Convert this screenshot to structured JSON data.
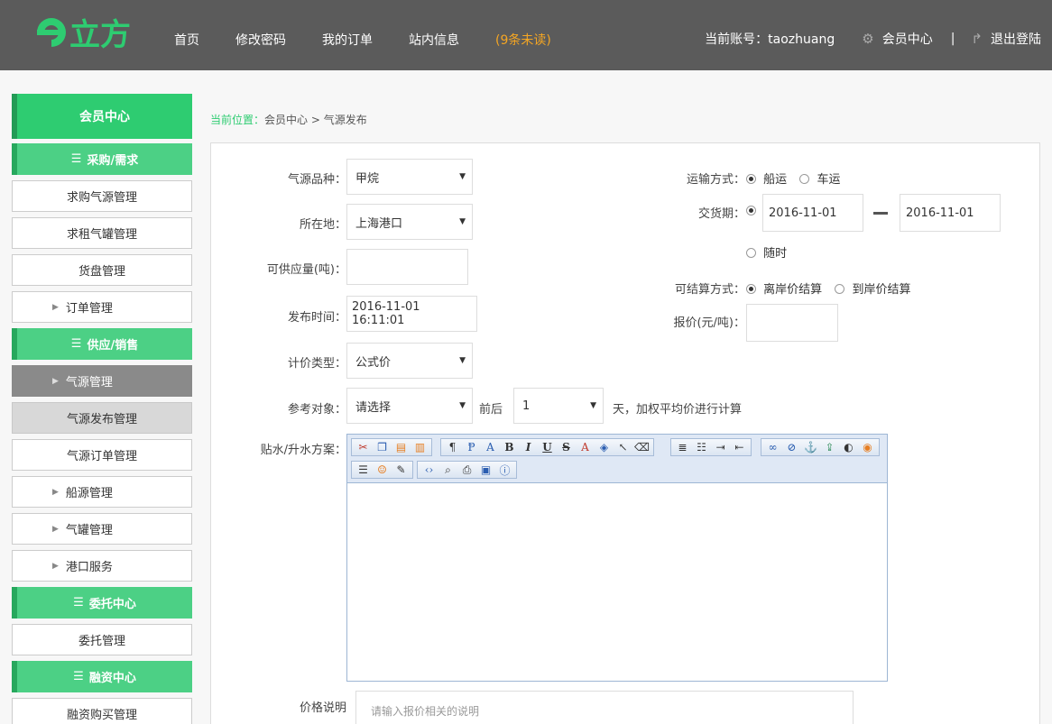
{
  "header": {
    "logo_text": "e立方",
    "nav": [
      "首页",
      "修改密码",
      "我的订单",
      "站内信息"
    ],
    "unread_text": "(9条未读)",
    "account_text": "当前账号：taozhuang",
    "member_center": "会员中心",
    "separator": "|",
    "logout": "退出登陆"
  },
  "sidebar": {
    "title": "会员中心",
    "groups": [
      {
        "label": "采购/需求",
        "items": [
          "求购气源管理",
          "求租气罐管理",
          "货盘管理",
          "订单管理"
        ]
      },
      {
        "label": "供应/销售",
        "items": [
          "气源管理",
          "气源发布管理",
          "气源订单管理",
          "船源管理",
          "气罐管理",
          "港口服务"
        ]
      },
      {
        "label": "委托中心",
        "items": [
          "委托管理"
        ]
      },
      {
        "label": "融资中心",
        "items": [
          "融资购买管理"
        ]
      }
    ]
  },
  "breadcrumb": {
    "lead": "当前位置：",
    "path": "会员中心 > 气源发布"
  },
  "form": {
    "gas_type_label": "气源品种：",
    "gas_type_value": "甲烷",
    "location_label": "所在地：",
    "location_value": "上海港口",
    "supply_label": "可供应量(吨)：",
    "supply_value": "",
    "publish_time_label": "发布时间：",
    "publish_time_value": "2016-11-01 16:11:01",
    "pricing_type_label": "计价类型：",
    "pricing_type_value": "公式价",
    "reference_label": "参考对象：",
    "reference_value": "请选择",
    "around_label": "前后",
    "around_value": "1",
    "around_suffix": "天，加权平均价进行计算",
    "plan_label": "贴水/升水方案：",
    "transport_label": "运输方式：",
    "transport_options": [
      "船运",
      "车运"
    ],
    "transport_selected": "船运",
    "delivery_label": "交货期：",
    "delivery_start": "2016-11-01",
    "delivery_end": "2016-11-01",
    "anytime_label": "随时",
    "settle_label": "可结算方式：",
    "settle_options": [
      "离岸价结算",
      "到岸价结算"
    ],
    "settle_selected": "离岸价结算",
    "price_label": "报价(元/吨)：",
    "price_value": "",
    "price_desc_label": "价格说明",
    "price_desc_placeholder": "请输入报价相关的说明"
  },
  "colors": {
    "accent": "#2ecc71",
    "header_bg": "#5b5b5b",
    "unread": "#f5a623"
  }
}
